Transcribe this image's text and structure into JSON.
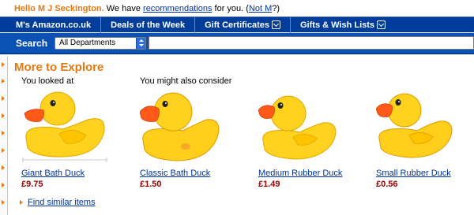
{
  "greeting": {
    "hello": "Hello M J Seckington.",
    "middle": "We have",
    "link": "recommendations",
    "after": "for you. (",
    "not_link": "Not M",
    "end": "?)"
  },
  "nav": {
    "items": [
      {
        "label": "M's Amazon.co.uk",
        "has_menu": false
      },
      {
        "label": "Deals of the Week",
        "has_menu": false
      },
      {
        "label": "Gift Certificates",
        "has_menu": true
      },
      {
        "label": "Gifts & Wish Lists",
        "has_menu": true
      }
    ]
  },
  "search": {
    "label": "Search",
    "department": "All Departments",
    "query": ""
  },
  "explore": {
    "title": "More to Explore",
    "looked_at": "You looked at",
    "consider": "You might also consider",
    "products": [
      {
        "title": "Giant Bath Duck",
        "price": "£9.75"
      },
      {
        "title": "Classic Bath Duck",
        "price": "£1.50"
      },
      {
        "title": "Medium Rubber Duck",
        "price": "£1.49"
      },
      {
        "title": "Small Rubber Duck",
        "price": "£0.56"
      }
    ],
    "find_similar": "Find similar items"
  },
  "colors": {
    "accent": "#e47911",
    "nav_bg": "#003d9a",
    "search_bg": "#0c52b4",
    "link": "#003399",
    "price": "#990000",
    "duck_yellow": "#ffd21f",
    "beak_orange": "#ff5a1a"
  }
}
